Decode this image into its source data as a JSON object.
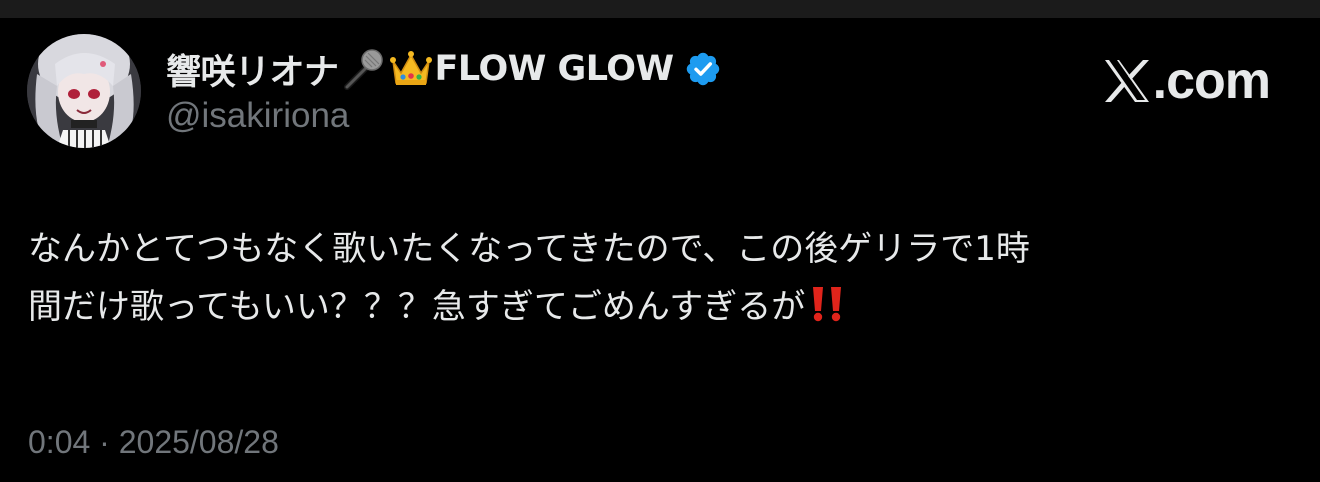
{
  "post": {
    "display_name": "響咲リオナ",
    "display_name_suffix": "FLOW GLOW",
    "handle": "@isakiriona",
    "body_line_1": "なんかとてつもなく歌いたくなってきたので、この後ゲリラで1時",
    "body_line_2": "間だけ歌ってもいい？？？急すぎてごめんすぎるが",
    "timestamp": "0:04 · 2025/08/28"
  },
  "brand": {
    "label": ".com"
  },
  "icons": {
    "avatar": "avatar-image",
    "microphone": "microphone-emoji-icon",
    "crown": "crown-emoji-icon",
    "verified": "verified-badge-icon",
    "x_logo": "x-logo-icon",
    "exclamation": "double-exclamation-icon"
  },
  "colors": {
    "background": "#000000",
    "primary_text": "#e7e9ea",
    "secondary_text": "#71767b",
    "verified_blue": "#1d9bf0",
    "exclamation_red": "#e0241b"
  }
}
